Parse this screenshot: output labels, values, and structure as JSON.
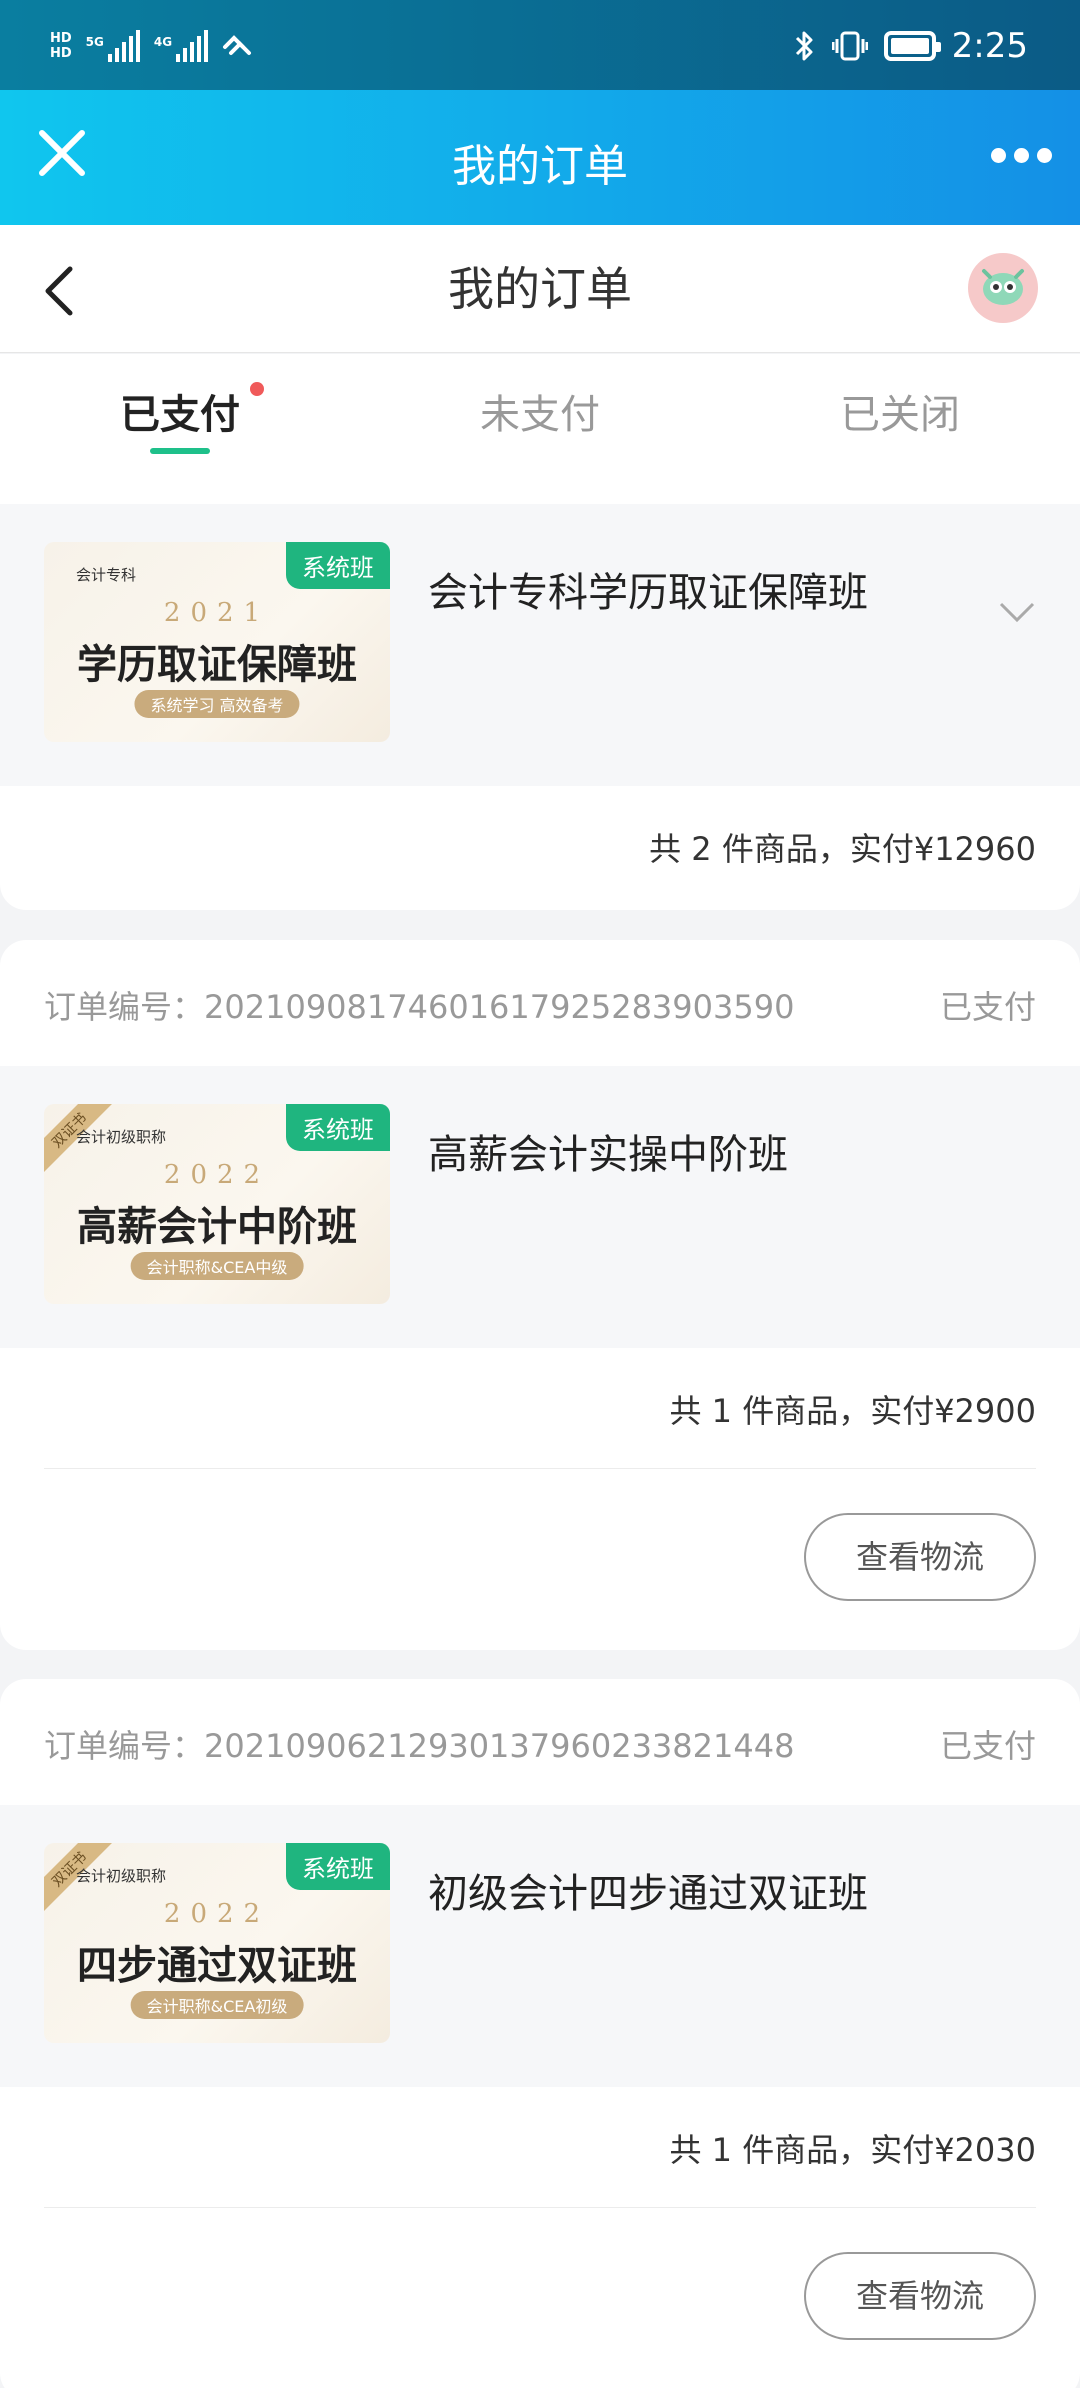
{
  "status_bar": {
    "hd1": "HD",
    "hd2": "HD",
    "net1": "5G",
    "net2": "4G",
    "time": "2:25"
  },
  "app_bar": {
    "title": "我的订单"
  },
  "nav": {
    "title": "我的订单"
  },
  "tabs": [
    {
      "label": "已支付",
      "active": true,
      "has_dot": true
    },
    {
      "label": "未支付",
      "active": false
    },
    {
      "label": "已关闭",
      "active": false
    }
  ],
  "orders": [
    {
      "product": {
        "tag": "系统班",
        "small_label": "会计专科",
        "year": "2021",
        "big_title": "学历取证保障班",
        "pill": "系统学习 高效备考",
        "name": "会计专科学历取证保障班"
      },
      "summary": "共 2 件商品，实付¥12960"
    },
    {
      "order_no_label": "订单编号：",
      "order_no": "20210908174601617925283903590",
      "status": "已支付",
      "product": {
        "tag": "系统班",
        "ribbon": "双证书",
        "small_label": "会计初级职称",
        "year": "2022",
        "big_title": "高薪会计中阶班",
        "pill": "会计职称&CEA中级",
        "name": "高薪会计实操中阶班"
      },
      "summary": "共 1 件商品，实付¥2900",
      "button": "查看物流"
    },
    {
      "order_no_label": "订单编号：",
      "order_no": "20210906212930137960233821448",
      "status": "已支付",
      "product": {
        "tag": "系统班",
        "ribbon": "双证书",
        "small_label": "会计初级职称",
        "year": "2022",
        "big_title": "四步通过双证班",
        "pill": "会计职称&CEA初级",
        "name": "初级会计四步通过双证班"
      },
      "summary": "共 1 件商品，实付¥2030",
      "button": "查看物流"
    }
  ],
  "colors": {
    "accent_green": "#1ec08a",
    "tag_green": "#1fb57f",
    "header_blue": "#1490e6",
    "badge_red": "#f05a5a"
  }
}
